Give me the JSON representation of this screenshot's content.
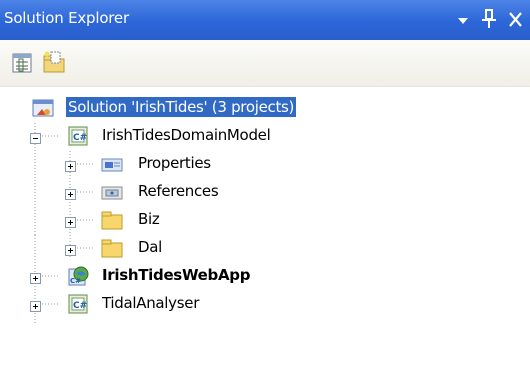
{
  "window": {
    "title": "Solution Explorer",
    "buttons": [
      "dropdown-arrow-icon",
      "pin-icon",
      "close-icon"
    ]
  },
  "toolbar": {
    "items": [
      {
        "name": "properties-icon"
      },
      {
        "name": "show-all-files-icon"
      }
    ]
  },
  "tree": {
    "solution": {
      "label": "Solution 'IrishTides' (3 projects)",
      "selected": true,
      "icon": "solution-icon"
    },
    "projects": [
      {
        "label": "IrishTidesDomainModel",
        "icon": "csharp-project-icon",
        "expanded": true,
        "children": [
          {
            "label": "Properties",
            "icon": "properties-folder-icon"
          },
          {
            "label": "References",
            "icon": "references-icon"
          },
          {
            "label": "Biz",
            "icon": "folder-icon"
          },
          {
            "label": "Dal",
            "icon": "folder-icon"
          }
        ]
      },
      {
        "label": "IrishTidesWebApp",
        "icon": "web-project-icon",
        "bold": true,
        "expanded": false
      },
      {
        "label": "TidalAnalyser",
        "icon": "csharp-project-icon",
        "expanded": false
      }
    ]
  },
  "colors": {
    "titlebar": "#2c66d8",
    "selection": "#316ac5",
    "folder": "#f7d76b"
  }
}
